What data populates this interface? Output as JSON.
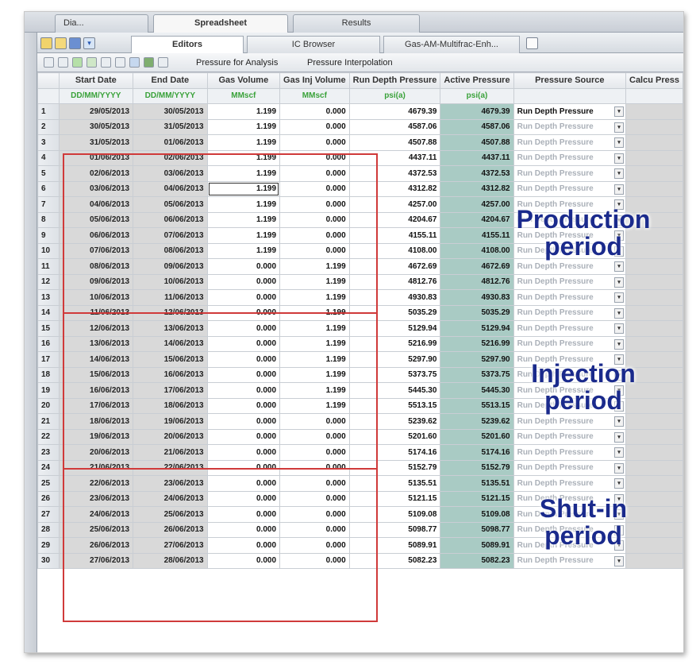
{
  "top_tabs": [
    "Dia...",
    "Spreadsheet",
    "Results"
  ],
  "second_tabs": [
    "Editors",
    "IC Browser",
    "Gas-AM-Multifrac-Enh..."
  ],
  "toolbar": {
    "pressure_for_analysis": "Pressure for Analysis",
    "pressure_interpolation": "Pressure Interpolation"
  },
  "columns": [
    {
      "header": "Start Date",
      "unit": "DD/MM/YYYY"
    },
    {
      "header": "End Date",
      "unit": "DD/MM/YYYY"
    },
    {
      "header": "Gas Volume",
      "unit": "MMscf"
    },
    {
      "header": "Gas Inj Volume",
      "unit": "MMscf"
    },
    {
      "header": "Run Depth Pressure",
      "unit": "psi(a)"
    },
    {
      "header": "Active Pressure",
      "unit": "psi(a)"
    },
    {
      "header": "Pressure Source",
      "unit": ""
    },
    {
      "header": "Calcu Press",
      "unit": ""
    }
  ],
  "rows": [
    {
      "n": "1",
      "start": "29/05/2013",
      "end": "30/05/2013",
      "gas": "1.199",
      "inj": "0.000",
      "rdp": "4679.39",
      "active": "4679.39",
      "source": "Run Depth Pressure"
    },
    {
      "n": "2",
      "start": "30/05/2013",
      "end": "31/05/2013",
      "gas": "1.199",
      "inj": "0.000",
      "rdp": "4587.06",
      "active": "4587.06",
      "source": "Run Depth Pressure"
    },
    {
      "n": "3",
      "start": "31/05/2013",
      "end": "01/06/2013",
      "gas": "1.199",
      "inj": "0.000",
      "rdp": "4507.88",
      "active": "4507.88",
      "source": "Run Depth Pressure"
    },
    {
      "n": "4",
      "start": "01/06/2013",
      "end": "02/06/2013",
      "gas": "1.199",
      "inj": "0.000",
      "rdp": "4437.11",
      "active": "4437.11",
      "source": "Run Depth Pressure"
    },
    {
      "n": "5",
      "start": "02/06/2013",
      "end": "03/06/2013",
      "gas": "1.199",
      "inj": "0.000",
      "rdp": "4372.53",
      "active": "4372.53",
      "source": "Run Depth Pressure"
    },
    {
      "n": "6",
      "start": "03/06/2013",
      "end": "04/06/2013",
      "gas": "1.199",
      "inj": "0.000",
      "rdp": "4312.82",
      "active": "4312.82",
      "source": "Run Depth Pressure"
    },
    {
      "n": "7",
      "start": "04/06/2013",
      "end": "05/06/2013",
      "gas": "1.199",
      "inj": "0.000",
      "rdp": "4257.00",
      "active": "4257.00",
      "source": "Run Depth Pressure"
    },
    {
      "n": "8",
      "start": "05/06/2013",
      "end": "06/06/2013",
      "gas": "1.199",
      "inj": "0.000",
      "rdp": "4204.67",
      "active": "4204.67",
      "source": "Run Depth Pressure"
    },
    {
      "n": "9",
      "start": "06/06/2013",
      "end": "07/06/2013",
      "gas": "1.199",
      "inj": "0.000",
      "rdp": "4155.11",
      "active": "4155.11",
      "source": "Run Depth Pressure"
    },
    {
      "n": "10",
      "start": "07/06/2013",
      "end": "08/06/2013",
      "gas": "1.199",
      "inj": "0.000",
      "rdp": "4108.00",
      "active": "4108.00",
      "source": "Run Depth Pressure"
    },
    {
      "n": "11",
      "start": "08/06/2013",
      "end": "09/06/2013",
      "gas": "0.000",
      "inj": "1.199",
      "rdp": "4672.69",
      "active": "4672.69",
      "source": "Run Depth Pressure"
    },
    {
      "n": "12",
      "start": "09/06/2013",
      "end": "10/06/2013",
      "gas": "0.000",
      "inj": "1.199",
      "rdp": "4812.76",
      "active": "4812.76",
      "source": "Run Depth Pressure"
    },
    {
      "n": "13",
      "start": "10/06/2013",
      "end": "11/06/2013",
      "gas": "0.000",
      "inj": "1.199",
      "rdp": "4930.83",
      "active": "4930.83",
      "source": "Run Depth Pressure"
    },
    {
      "n": "14",
      "start": "11/06/2013",
      "end": "12/06/2013",
      "gas": "0.000",
      "inj": "1.199",
      "rdp": "5035.29",
      "active": "5035.29",
      "source": "Run Depth Pressure"
    },
    {
      "n": "15",
      "start": "12/06/2013",
      "end": "13/06/2013",
      "gas": "0.000",
      "inj": "1.199",
      "rdp": "5129.94",
      "active": "5129.94",
      "source": "Run Depth Pressure"
    },
    {
      "n": "16",
      "start": "13/06/2013",
      "end": "14/06/2013",
      "gas": "0.000",
      "inj": "1.199",
      "rdp": "5216.99",
      "active": "5216.99",
      "source": "Run Depth Pressure"
    },
    {
      "n": "17",
      "start": "14/06/2013",
      "end": "15/06/2013",
      "gas": "0.000",
      "inj": "1.199",
      "rdp": "5297.90",
      "active": "5297.90",
      "source": "Run Depth Pressure"
    },
    {
      "n": "18",
      "start": "15/06/2013",
      "end": "16/06/2013",
      "gas": "0.000",
      "inj": "1.199",
      "rdp": "5373.75",
      "active": "5373.75",
      "source": "Run Depth Pressure"
    },
    {
      "n": "19",
      "start": "16/06/2013",
      "end": "17/06/2013",
      "gas": "0.000",
      "inj": "1.199",
      "rdp": "5445.30",
      "active": "5445.30",
      "source": "Run Depth Pressure"
    },
    {
      "n": "20",
      "start": "17/06/2013",
      "end": "18/06/2013",
      "gas": "0.000",
      "inj": "1.199",
      "rdp": "5513.15",
      "active": "5513.15",
      "source": "Run Depth Pressure"
    },
    {
      "n": "21",
      "start": "18/06/2013",
      "end": "19/06/2013",
      "gas": "0.000",
      "inj": "0.000",
      "rdp": "5239.62",
      "active": "5239.62",
      "source": "Run Depth Pressure"
    },
    {
      "n": "22",
      "start": "19/06/2013",
      "end": "20/06/2013",
      "gas": "0.000",
      "inj": "0.000",
      "rdp": "5201.60",
      "active": "5201.60",
      "source": "Run Depth Pressure"
    },
    {
      "n": "23",
      "start": "20/06/2013",
      "end": "21/06/2013",
      "gas": "0.000",
      "inj": "0.000",
      "rdp": "5174.16",
      "active": "5174.16",
      "source": "Run Depth Pressure"
    },
    {
      "n": "24",
      "start": "21/06/2013",
      "end": "22/06/2013",
      "gas": "0.000",
      "inj": "0.000",
      "rdp": "5152.79",
      "active": "5152.79",
      "source": "Run Depth Pressure"
    },
    {
      "n": "25",
      "start": "22/06/2013",
      "end": "23/06/2013",
      "gas": "0.000",
      "inj": "0.000",
      "rdp": "5135.51",
      "active": "5135.51",
      "source": "Run Depth Pressure"
    },
    {
      "n": "26",
      "start": "23/06/2013",
      "end": "24/06/2013",
      "gas": "0.000",
      "inj": "0.000",
      "rdp": "5121.15",
      "active": "5121.15",
      "source": "Run Depth Pressure"
    },
    {
      "n": "27",
      "start": "24/06/2013",
      "end": "25/06/2013",
      "gas": "0.000",
      "inj": "0.000",
      "rdp": "5109.08",
      "active": "5109.08",
      "source": "Run Depth Pressure"
    },
    {
      "n": "28",
      "start": "25/06/2013",
      "end": "26/06/2013",
      "gas": "0.000",
      "inj": "0.000",
      "rdp": "5098.77",
      "active": "5098.77",
      "source": "Run Depth Pressure"
    },
    {
      "n": "29",
      "start": "26/06/2013",
      "end": "27/06/2013",
      "gas": "0.000",
      "inj": "0.000",
      "rdp": "5089.91",
      "active": "5089.91",
      "source": "Run Depth Pressure"
    },
    {
      "n": "30",
      "start": "27/06/2013",
      "end": "28/06/2013",
      "gas": "0.000",
      "inj": "0.000",
      "rdp": "5082.23",
      "active": "5082.23",
      "source": "Run Depth Pressure"
    }
  ],
  "annotations": {
    "production": {
      "line1": "Production",
      "line2": "period"
    },
    "injection": {
      "line1": "Injection",
      "line2": "period"
    },
    "shutin": {
      "line1": "Shut-in",
      "line2": "period"
    }
  },
  "colors": {
    "unit_text": "#3aa23a",
    "active_column": "#a9cbc4",
    "period_box": "#d03a3a",
    "annotation_text": "#1a2a8c"
  },
  "icons": [
    "open-folder-icon",
    "save-icon",
    "grid-view-icon",
    "undo-icon",
    "redo-icon",
    "refresh-icon",
    "find-icon",
    "print-icon",
    "export-icon",
    "chart-icon",
    "clear-icon",
    "new-tab-icon"
  ]
}
